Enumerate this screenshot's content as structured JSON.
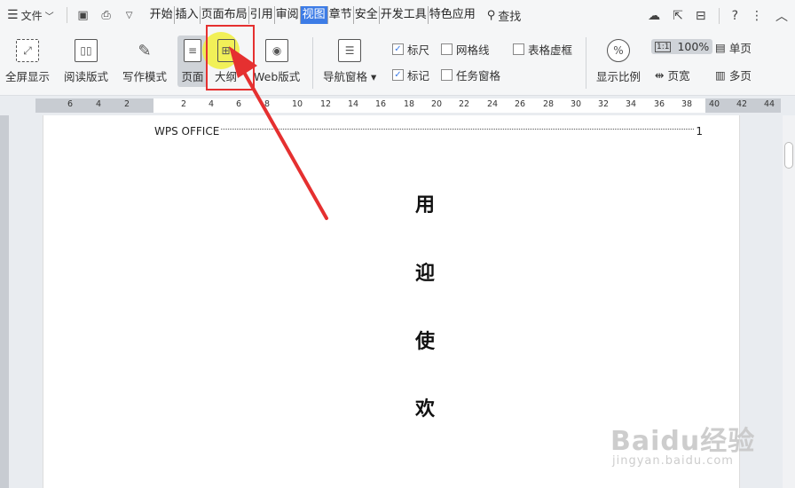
{
  "menubar": {
    "file_label": "文件",
    "tabs": [
      {
        "label": "开始"
      },
      {
        "label": "插入"
      },
      {
        "label": "页面布局"
      },
      {
        "label": "引用"
      },
      {
        "label": "审阅"
      },
      {
        "label": "视图"
      },
      {
        "label": "章节"
      },
      {
        "label": "安全"
      },
      {
        "label": "开发工具"
      },
      {
        "label": "特色应用"
      }
    ],
    "active_tab": "视图",
    "search_label": "查找"
  },
  "ribbon": {
    "fullscreen": "全屏显示",
    "reading": "阅读版式",
    "writing": "写作模式",
    "page": "页面",
    "outline": "大纲",
    "web": "Web版式",
    "nav_pane": "导航窗格",
    "ruler": "标尺",
    "gridlines": "网格线",
    "table_gridlines": "表格虚框",
    "marks": "标记",
    "task_pane": "任务窗格",
    "zoom_ratio": "显示比例",
    "zoom_100": "100%",
    "page_width": "页宽",
    "single_page": "单页",
    "multi_page": "多页"
  },
  "checks": {
    "ruler": true,
    "gridlines": false,
    "table_gridlines": false,
    "marks": true,
    "task_pane": false
  },
  "ruler_ticks": [
    "6",
    "4",
    "2",
    "2",
    "4",
    "6",
    "8",
    "10",
    "12",
    "14",
    "16",
    "18",
    "20",
    "22",
    "24",
    "26",
    "28",
    "30",
    "32",
    "34",
    "36",
    "38",
    "40",
    "42",
    "44"
  ],
  "document": {
    "toc_title": "WPS OFFICE",
    "toc_page": "1",
    "vertical_chars": [
      "用",
      "迎",
      "使",
      "欢"
    ]
  },
  "watermark": {
    "brand": "Baidu经验",
    "url": "jingyan.baidu.com"
  },
  "colors": {
    "accent": "#3d7ce6",
    "highlight": "#e53030",
    "marker": "#f0ee3c"
  }
}
